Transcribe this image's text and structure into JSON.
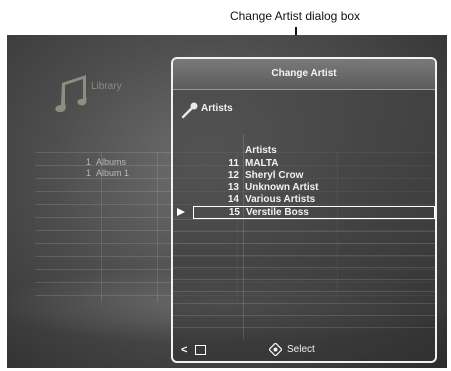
{
  "annotation": {
    "label": "Change Artist dialog box"
  },
  "background": {
    "library_label": "Library",
    "items": [
      {
        "num": "1",
        "label": "Albums"
      },
      {
        "num": "1",
        "label": "Album 1"
      }
    ]
  },
  "dialog": {
    "title": "Change Artist",
    "heading": "Artists",
    "list_header": "Artists",
    "rows": [
      {
        "num": "11",
        "name": "MALTA"
      },
      {
        "num": "12",
        "name": "Sheryl Crow"
      },
      {
        "num": "13",
        "name": "Unknown Artist"
      },
      {
        "num": "14",
        "name": "Various Artists"
      },
      {
        "num": "15",
        "name": "Verstile Boss"
      }
    ],
    "selected_index": 4,
    "footer": {
      "back_symbol": "<",
      "select_label": "Select"
    }
  }
}
